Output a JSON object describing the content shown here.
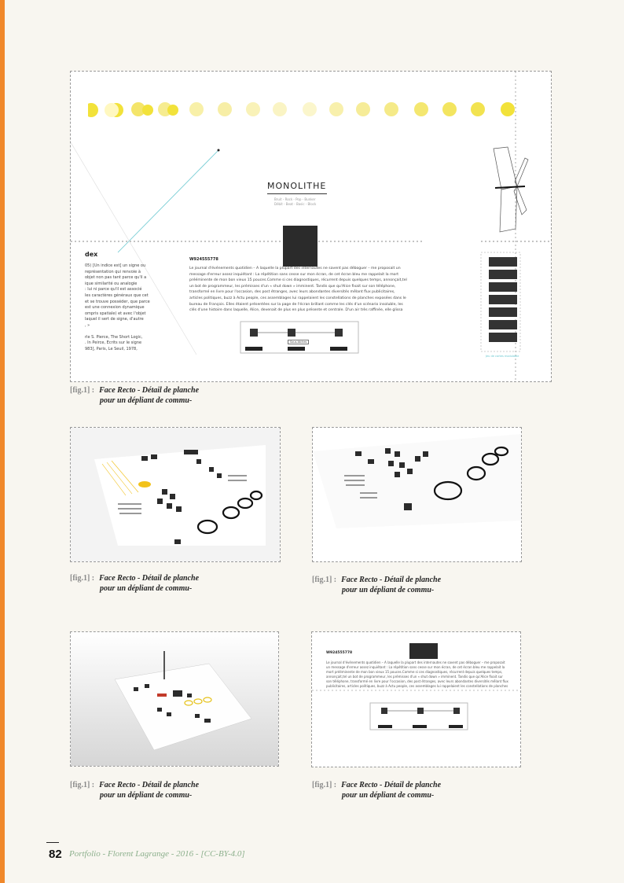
{
  "fig_tag": "[fig.1] :",
  "caption_line1": "Face Recto - Détail de planche",
  "caption_line2": "pour un dépliant de commu-",
  "poster": {
    "title": "MONOLITHE",
    "subtitle_1": "Bruit - Rock - Pop - Bunker",
    "subtitle_2": "Débit - Beat - Basic - Block",
    "code": "W924555778",
    "body_text": "Le journal d'événements quotidien – A laquelle la plupart des internautes ne savent pas déboguer – me proposait un message d'erreur assez inquiétant : La répétition sans cesse sur mon écran, de cet écran bleu me rappelait la mort prééminente de mon bon vieux 15 pouces.Comme si ces diagnostiques, récurrent depuis quelques temps, annonçait,tel un bot de programmeur, les prémisses d'un « shut down » imminent. Tandis que qu'Alice fixait sur son téléphone, transformé en livre pour l'occasion, des post étranges, avec leurs abondantes diversités mêlant flux publicitaires, articles politiques, buzz à Actu people, ces assemblages lui rappelaient les constellations de planches exposées dans le bureau de François. Elles étaient présentées sur la page de l'écran brillant comme les clés d'un scénario insoluble, les clés d'une histoire dans laquelle, Alice, devenait de plus en plus présente et centrale. D'un air très raffinée, elle glissa son doigt sur l'écran lorsque le développeur Vilnius s'approcha en tenant un chargeur",
    "index_heading": "dex",
    "index_lines": [
      "05) [Un indice est] un signe ou",
      "représentation qui renvoie à",
      "objet non pas tant parce qu'il a",
      "ique similarité ou analogie",
      ": lui ni parce qu'il est associé",
      "les caractères généraux que cet",
      "et se trouve posséder, que parce",
      "est une connexion dynamique",
      "ompris spatiale) et avec l'objet",
      "laquel il sert de signe, d'autre",
      ", »",
      "",
      "rle S. Pierce, The Short Logic,",
      ". In Peirce, Ecrits sur le signe",
      "983], Paris, Le Seuil, 1978,"
    ],
    "diagram_label": "Sous-tâches",
    "right_caption": "Jeu de cartes modulable"
  },
  "footer": {
    "page_number": "82",
    "credit": "Portfolio - Florent Lagrange - 2016 - [CC-BY-4.0]"
  },
  "colors": {
    "accent": "#f0882a",
    "moon_yellow": "#f2e23a",
    "footer_green": "#8db08d",
    "cyan_line": "#69c8d0"
  }
}
